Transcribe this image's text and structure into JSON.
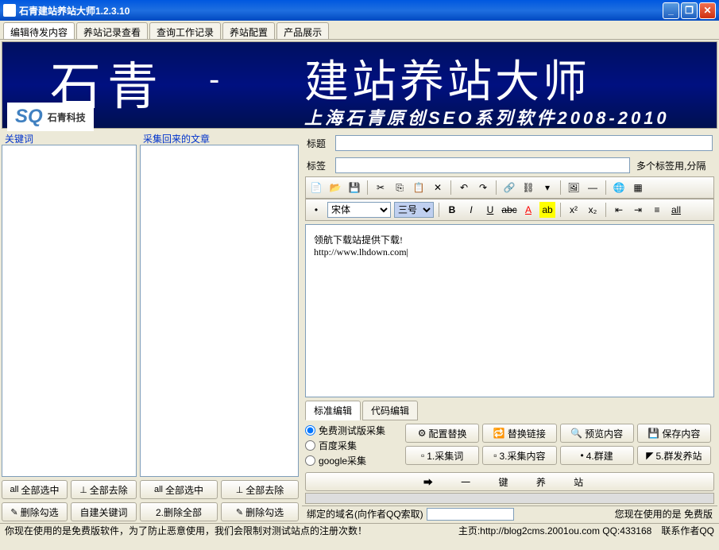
{
  "window": {
    "title": "石青建站养站大师1.2.3.10"
  },
  "tabs": [
    "编辑待发内容",
    "养站记录查看",
    "查询工作记录",
    "养站配置",
    "产品展示"
  ],
  "banner": {
    "big1": "石青",
    "big2": "建站养站大师",
    "sub": "上海石青原创SEO系列软件2008-2010",
    "logo_sq": "SQ",
    "logo_text": "石青科技"
  },
  "left": {
    "label": "关键词",
    "btn_select_all": "全部选中",
    "btn_remove_all": "全部去除",
    "btn_delete_checked": "删除勾选",
    "btn_self_keyword": "自建关键词"
  },
  "mid": {
    "label": "采集回来的文章",
    "btn_select_all": "全部选中",
    "btn_remove_all": "全部去除",
    "btn_delete_all": "2.删除全部",
    "btn_delete_checked": "删除勾选"
  },
  "form": {
    "title_label": "标题",
    "title_value": "",
    "tag_label": "标签",
    "tag_value": "",
    "tag_hint": "多个标签用,分隔"
  },
  "editor": {
    "font": "宋体",
    "size": "三号",
    "content": "领航下载站提供下载!\nhttp://www.lhdown.com|"
  },
  "edittabs": [
    "标准编辑",
    "代码编辑"
  ],
  "radios": [
    "免费测试版采集",
    "百度采集",
    "google采集"
  ],
  "action_buttons": {
    "config_replace": "配置替换",
    "replace_link": "替换链接",
    "preview": "预览内容",
    "save": "保存内容",
    "collect_word": "1.采集词",
    "collect_content": "3.采集内容",
    "group": "4.群建",
    "group_send": "5.群发养站"
  },
  "bigbutton": "➡   一    键    养    站",
  "status": {
    "domain_label": "绑定的域名(向作者QQ索取)",
    "domain_value": "",
    "version_text": "您现在使用的是 免费版"
  },
  "footer": {
    "warning": "你现在使用的是免费版软件，为了防止恶意使用，我们会限制对测试站点的注册次数！",
    "homepage": "主页:http://blog2cms.2001ou.com QQ:433168",
    "contact": "联系作者QQ"
  }
}
